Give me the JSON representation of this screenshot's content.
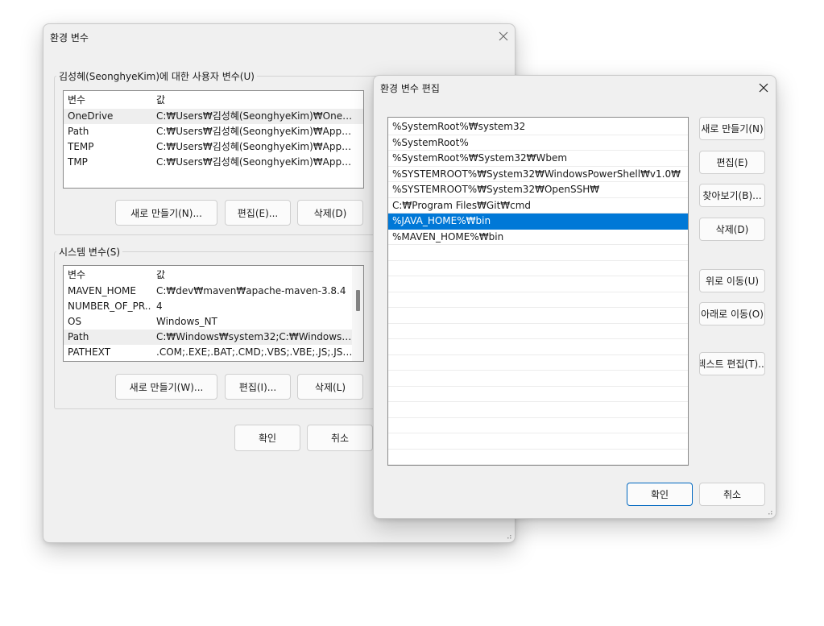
{
  "env_window": {
    "title": "환경 변수",
    "user_group": {
      "label": "김성혜(SeonghyeKim)에 대한 사용자 변수(U)",
      "columns": [
        "변수",
        "값"
      ],
      "rows": [
        {
          "name": "OneDrive",
          "value": "C:₩Users₩김성혜(SeonghyeKim)₩OneDri..."
        },
        {
          "name": "Path",
          "value": "C:₩Users₩김성혜(SeonghyeKim)₩AppDat..."
        },
        {
          "name": "TEMP",
          "value": "C:₩Users₩김성혜(SeonghyeKim)₩AppDat..."
        },
        {
          "name": "TMP",
          "value": "C:₩Users₩김성혜(SeonghyeKim)₩AppDat..."
        }
      ],
      "buttons": {
        "new": "새로 만들기(N)...",
        "edit": "편집(E)...",
        "delete": "삭제(D)"
      }
    },
    "system_group": {
      "label": "시스템 변수(S)",
      "columns": [
        "변수",
        "값"
      ],
      "rows": [
        {
          "name": "MAVEN_HOME",
          "value": "C:₩dev₩maven₩apache-maven-3.8.4"
        },
        {
          "name": "NUMBER_OF_PR...",
          "value": "4"
        },
        {
          "name": "OS",
          "value": "Windows_NT"
        },
        {
          "name": "Path",
          "value": "C:₩Windows₩system32;C:₩Windows;C:₩..."
        },
        {
          "name": "PATHEXT",
          "value": ".COM;.EXE;.BAT;.CMD;.VBS;.VBE;.JS;.JSE;.W..."
        }
      ],
      "buttons": {
        "new": "새로 만들기(W)...",
        "edit": "편집(I)...",
        "delete": "삭제(L)"
      }
    },
    "ok": "확인",
    "cancel": "취소"
  },
  "edit_window": {
    "title": "환경 변수 편집",
    "entries": [
      "%SystemRoot%₩system32",
      "%SystemRoot%",
      "%SystemRoot%₩System32₩Wbem",
      "%SYSTEMROOT%₩System32₩WindowsPowerShell₩v1.0₩",
      "%SYSTEMROOT%₩System32₩OpenSSH₩",
      "C:₩Program Files₩Git₩cmd",
      "%JAVA_HOME%₩bin",
      "%MAVEN_HOME%₩bin"
    ],
    "buttons": {
      "new": "새로 만들기(N)",
      "edit": "편집(E)",
      "browse": "찾아보기(B)...",
      "delete": "삭제(D)",
      "move_up": "위로 이동(U)",
      "move_down": "아래로 이동(O)",
      "edit_text": "텍스트 편집(T)..."
    },
    "ok": "확인",
    "cancel": "취소"
  }
}
